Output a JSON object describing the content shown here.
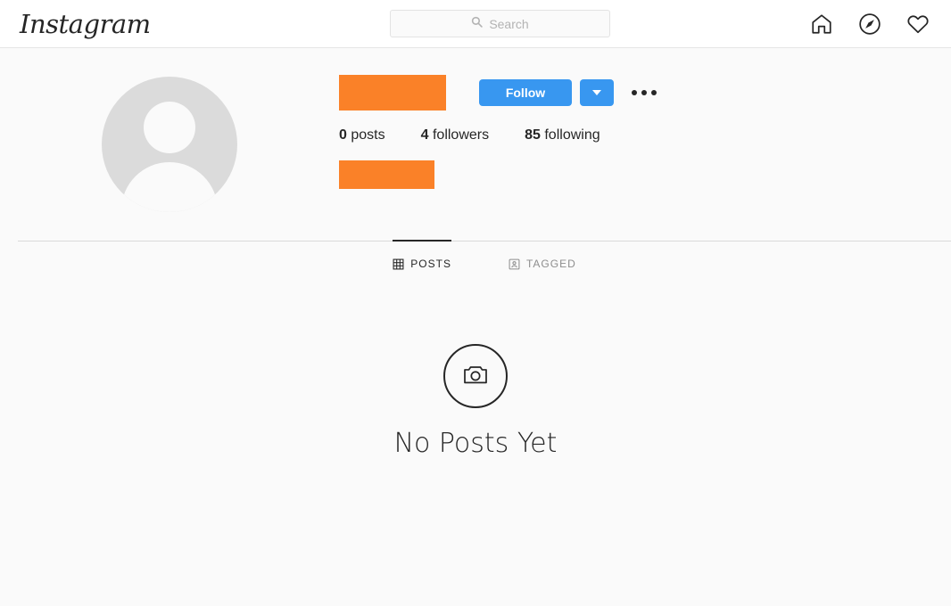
{
  "header": {
    "logo_text": "Instagram",
    "search": {
      "placeholder": "Search",
      "value": "",
      "icon": "search-icon"
    },
    "nav": [
      {
        "name": "home-icon",
        "label": "Home"
      },
      {
        "name": "explore-icon",
        "label": "Explore"
      },
      {
        "name": "activity-icon",
        "label": "Activity"
      }
    ]
  },
  "profile": {
    "avatar": {
      "name": "default-avatar",
      "alt": "Default profile photo"
    },
    "username_redacted": true,
    "bio_redacted": true,
    "actions": {
      "follow_label": "Follow",
      "dropdown_icon": "chevron-down-icon",
      "options_icon": "more-options-icon"
    },
    "stats": [
      {
        "name": "posts",
        "value": "0",
        "label": "posts"
      },
      {
        "name": "followers",
        "value": "4",
        "label": "followers"
      },
      {
        "name": "following",
        "value": "85",
        "label": "following"
      }
    ]
  },
  "tabs": [
    {
      "name": "tab-posts",
      "label": "POSTS",
      "icon": "grid-icon",
      "active": true
    },
    {
      "name": "tab-tagged",
      "label": "TAGGED",
      "icon": "tagged-icon",
      "active": false
    }
  ],
  "empty_state": {
    "icon": "camera-icon",
    "message": "No Posts Yet"
  },
  "colors": {
    "accent_blue": "#3897f0",
    "redaction_orange": "#fa8128",
    "text_primary": "#262626",
    "text_secondary": "#8e8e8e",
    "page_background": "#fafafa"
  }
}
